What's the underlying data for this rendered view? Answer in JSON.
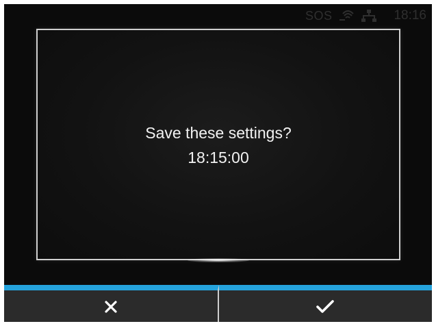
{
  "status_bar": {
    "sos_label": "SOS",
    "time": "18:16",
    "icons": [
      "wifi-signal-icon",
      "network-icon"
    ]
  },
  "dialog": {
    "message": "Save these settings?",
    "value": "18:15:00"
  },
  "buttons": {
    "cancel_icon": "close-icon",
    "confirm_icon": "checkmark-icon"
  },
  "colors": {
    "screen_background": "#0b0b0b",
    "dialog_border": "#d0d0d0",
    "button_accent": "#25a3dc",
    "button_background": "#2b2b2b",
    "text": "#f2f2f2"
  }
}
